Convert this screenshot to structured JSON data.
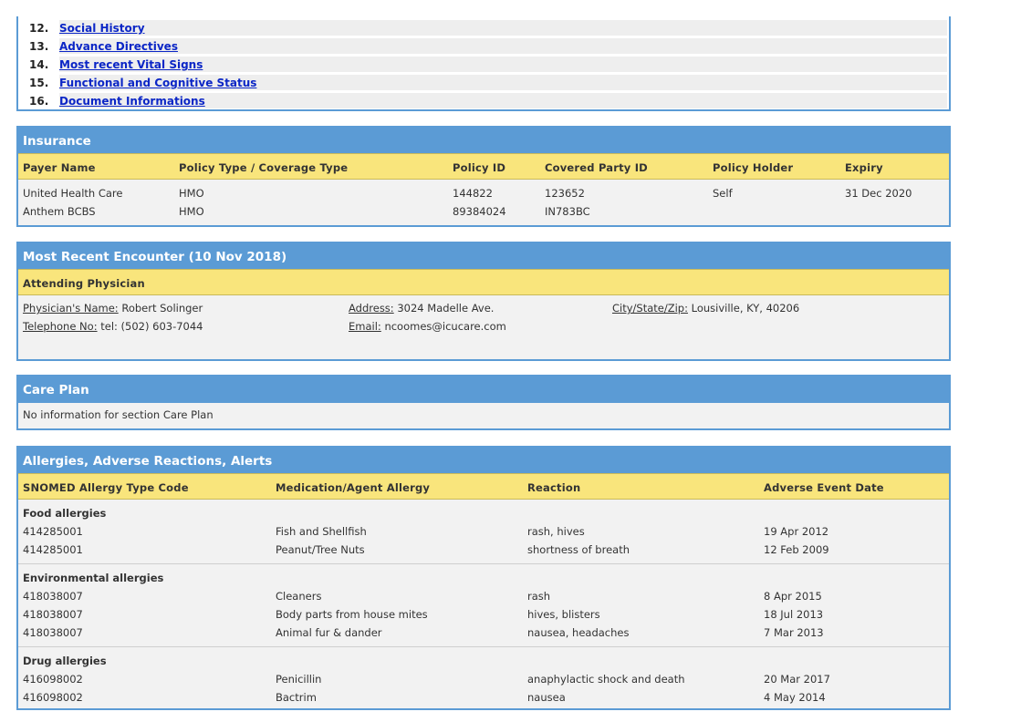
{
  "toc": [
    {
      "num": "12.",
      "label": "Social History"
    },
    {
      "num": "13.",
      "label": "Advance Directives"
    },
    {
      "num": "14.",
      "label": "Most recent Vital Signs"
    },
    {
      "num": "15.",
      "label": "Functional and Cognitive Status"
    },
    {
      "num": "16.",
      "label": "Document Informations"
    }
  ],
  "insurance": {
    "title": "Insurance",
    "headers": [
      "Payer Name",
      "Policy Type / Coverage Type",
      "Policy ID",
      "Covered Party ID",
      "Policy Holder",
      "Expiry"
    ],
    "rows": [
      [
        "United Health Care",
        "HMO",
        "144822",
        "123652",
        "Self",
        "31 Dec 2020"
      ],
      [
        "Anthem BCBS",
        "HMO",
        "89384024",
        "IN783BC",
        "",
        ""
      ]
    ]
  },
  "encounter": {
    "title": "Most Recent Encounter (10 Nov 2018)",
    "subheader": "Attending Physician",
    "name_label": "Physician's Name:",
    "name_value": "Robert Solinger",
    "address_label": "Address:",
    "address_value": "3024 Madelle Ave.",
    "city_label": "City/State/Zip:",
    "city_value": "Lousiville, KY, 40206",
    "phone_label": "Telephone No:",
    "phone_value": "tel: (502) 603-7044",
    "email_label": "Email:",
    "email_value": "ncoomes@icucare.com"
  },
  "care_plan": {
    "title": "Care Plan",
    "message": "No information for section Care Plan"
  },
  "allergies": {
    "title": "Allergies, Adverse Reactions, Alerts",
    "headers": [
      "SNOMED Allergy Type Code",
      "Medication/Agent Allergy",
      "Reaction",
      "Adverse Event Date"
    ],
    "groups": [
      {
        "name": "Food allergies",
        "rows": [
          [
            "414285001",
            "Fish and Shellfish",
            "rash, hives",
            "19 Apr 2012"
          ],
          [
            "414285001",
            "Peanut/Tree Nuts",
            "shortness of breath",
            "12 Feb 2009"
          ]
        ]
      },
      {
        "name": "Environmental allergies",
        "rows": [
          [
            "418038007",
            "Cleaners",
            "rash",
            "8 Apr 2015"
          ],
          [
            "418038007",
            "Body parts from house mites",
            "hives, blisters",
            "18 Jul 2013"
          ],
          [
            "418038007",
            "Animal fur & dander",
            "nausea, headaches",
            "7 Mar 2013"
          ]
        ]
      },
      {
        "name": "Drug allergies",
        "rows": [
          [
            "416098002",
            "Penicillin",
            "anaphylactic shock and death",
            "20 Mar 2017"
          ],
          [
            "416098002",
            "Bactrim",
            "nausea",
            "4 May 2014"
          ]
        ]
      }
    ]
  }
}
